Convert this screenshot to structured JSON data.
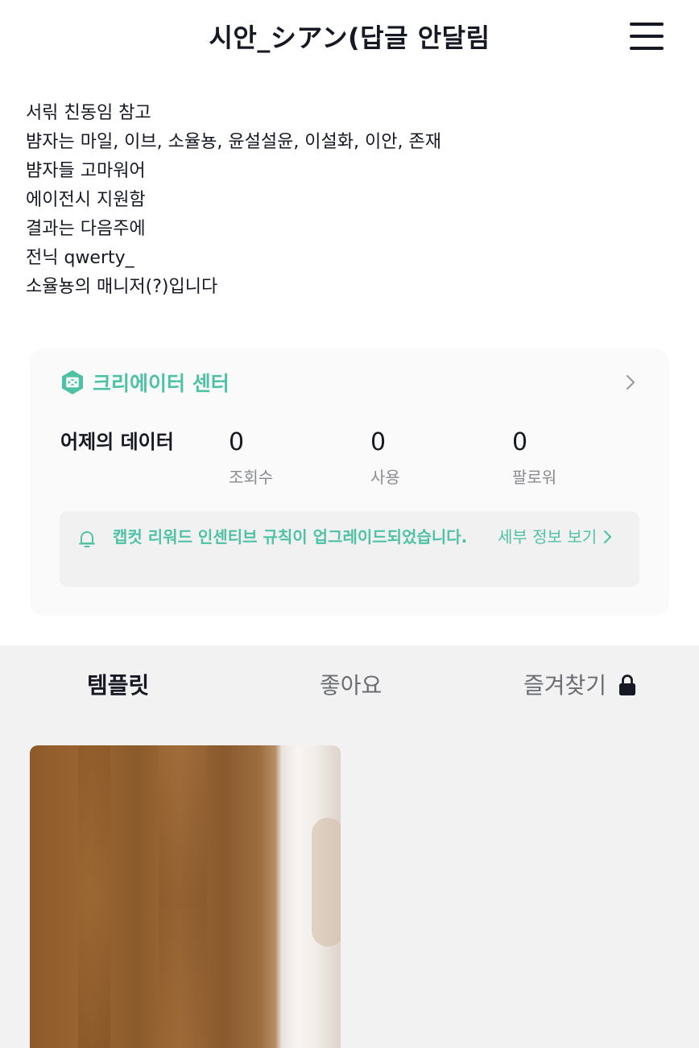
{
  "header": {
    "title": "시안_シアン(답글 안달림",
    "menu_icon": "hamburger-menu-icon"
  },
  "bio": {
    "lines": [
      "서릮 친동임 참고",
      "뱜자는 마일, 이브, 소율뇽, 윤설설윤, 이설화, 이안, 존재",
      "뱜자들 고마워어",
      "에이전시 지원함",
      "결과는 다음주에",
      "전닉 qwerty_",
      "소율뇽의 매니저(?)입니다"
    ]
  },
  "creator_center": {
    "title": "크리에이터 센터",
    "icon": "capcut-logo-icon",
    "stats_label": "어제의 데이터",
    "stats": [
      {
        "value": "0",
        "label": "조회수"
      },
      {
        "value": "0",
        "label": "사용"
      },
      {
        "value": "0",
        "label": "팔로워"
      }
    ],
    "notice": {
      "text": "캡컷 리워드 인센티브 규칙이 업그레이드되었습니다.",
      "link": "세부 정보 보기",
      "icon": "bell-icon"
    }
  },
  "tabs": [
    {
      "label": "템플릿",
      "active": true
    },
    {
      "label": "좋아요",
      "active": false
    },
    {
      "label": "즐겨찾기",
      "active": false,
      "icon": "lock-icon"
    }
  ],
  "colors": {
    "accent": "#4fc2a6",
    "text_primary": "#161823",
    "text_secondary": "#8a8b91",
    "tab_area_bg": "#f2f2f2"
  }
}
